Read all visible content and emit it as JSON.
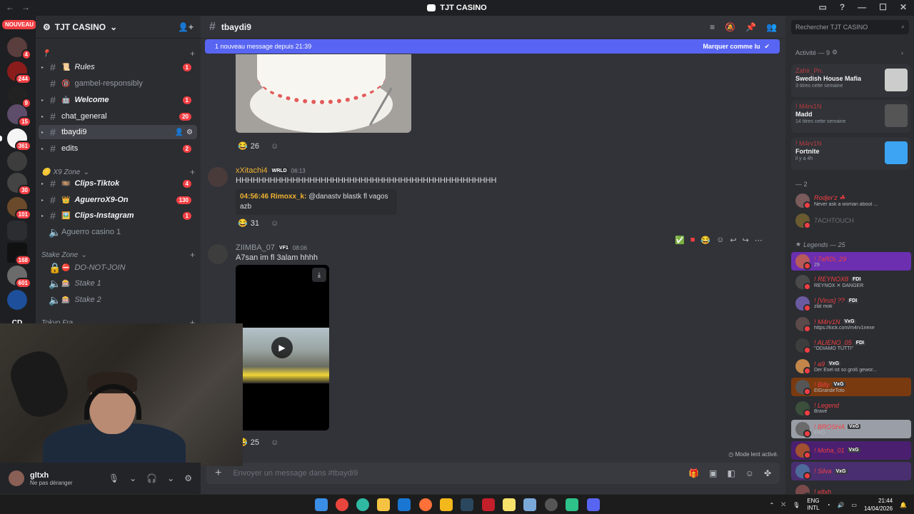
{
  "window": {
    "title": "TJT CASINO"
  },
  "server": {
    "name": "TJT CASINO"
  },
  "guild_badges": {
    "new": "NOUVEAU",
    "b1": "4",
    "b2": "244",
    "b3": "9",
    "b4": "15",
    "b5": "361",
    "b6": "30",
    "b7": "101",
    "b8": "168",
    "b9": "601",
    "cd": "CD"
  },
  "categories": {
    "cat1": "📍",
    "x9": "X9 Zone",
    "stake": "Stake Zone",
    "tokyo": "Tokyo Fra"
  },
  "channels": {
    "rules": {
      "label": "Rules",
      "emoji": "📜",
      "count": "1"
    },
    "gamble": {
      "label": "gambel-responsibly",
      "emoji": "🔞"
    },
    "welcome": {
      "label": "Welcome",
      "emoji": "🤖",
      "count": "1"
    },
    "chat_general": {
      "label": "chat_general",
      "count": "20"
    },
    "tbaydi9": {
      "label": "tbaydi9"
    },
    "edits": {
      "label": "edits",
      "count": "2"
    },
    "clips_tiktok": {
      "label": "Clips-Tiktok",
      "emoji": "🎞️",
      "count": "4"
    },
    "aguerro": {
      "label": "AguerroX9-On",
      "emoji": "👑",
      "count": "130"
    },
    "clips_insta": {
      "label": "Clips-Instagram",
      "emoji": "🖼️",
      "count": "1"
    },
    "aguerro_voice": {
      "label": "Aguerro casino 1"
    },
    "do_not_join": {
      "label": "DO-NOT-JOIN",
      "emoji": "⛔"
    },
    "stake1": {
      "label": "Stake 1",
      "emoji": "🎰"
    },
    "stake2": {
      "label": "Stake 2",
      "emoji": "🎰"
    }
  },
  "user": {
    "name": "gltxh",
    "status": "Ne pas déranger"
  },
  "header": {
    "channel": "tbaydi9"
  },
  "newbar": {
    "text": "1 nouveau message depuis 21:39",
    "action": "Marquer comme lu"
  },
  "messages": {
    "r1": {
      "emoji": "😂",
      "count": "26"
    },
    "m2": {
      "author": "xXitachi4",
      "tag": "WRLD",
      "time": "06:13",
      "text": "HHHHHHHHHHHHHHHHHHHHHHHHHHHHHHHHHHHHHHHHHHHHHH",
      "quote_time": "04:56:46",
      "quote_author": "Rimoxx_k:",
      "quote_text": "@danastv blastk fl vagos",
      "quote_text2": "azb"
    },
    "r2": {
      "emoji": "😂",
      "count": "31"
    },
    "m3": {
      "author": "ZIIMBA_07",
      "tag": "VF1",
      "time": "08:06",
      "text": "A7san im fl 3alam hhhh"
    },
    "r3": {
      "emoji": "😂",
      "count": "25"
    }
  },
  "slowmode": "Mode lent activé.",
  "composer": {
    "placeholder": "Envoyer un message dans #tbaydi9"
  },
  "search": {
    "placeholder": "Rechercher TJT CASINO"
  },
  "activity_header": "Activité — 9",
  "activities": [
    {
      "who": "Zahir_Pn.",
      "what": "Swedish House Mafia",
      "sub": "3 titres cette semaine"
    },
    {
      "who": "! M4rv1N",
      "what": "Madd",
      "sub": "14 titres cette semaine"
    },
    {
      "who": "! M4rv1N",
      "what": "Fortnite",
      "sub": "il y a 4h"
    }
  ],
  "group2_header": "— 2",
  "group2": [
    {
      "name": "Rodjer'z ☘",
      "status": "Never ask a woman about ..."
    },
    {
      "name": "7ACHTOUCH",
      "status": ""
    }
  ],
  "legends_header": "Legends — 25",
  "legends": [
    {
      "name": "! 7aRDi_29",
      "tag": "",
      "status": "29"
    },
    {
      "name": "! REYNOX8",
      "tag": "FDI",
      "status": "REYNOX ✕ DANGER"
    },
    {
      "name": "! [Virus] ??",
      "tag": "FDI",
      "status": "zlal mok"
    },
    {
      "name": "! M4rv1N",
      "tag": "VxG",
      "status": "https://kick.com/m4rv1nexe"
    },
    {
      "name": "! ALIENO_05",
      "tag": "FDI",
      "status": "\"ODIAMO TUTTI\""
    },
    {
      "name": "! a9",
      "tag": "VxG",
      "status": "Der Esel ist so groß gewor..."
    },
    {
      "name": "! Billy",
      "tag": "VxG",
      "status": "ElGrandeToto"
    },
    {
      "name": "! Legend",
      "tag": "",
      "status": "Brave"
    },
    {
      "name": "! BROSHA",
      "tag": "VxG",
      "status": "ERO"
    },
    {
      "name": "! Moha_01",
      "tag": "VxG",
      "status": ""
    },
    {
      "name": "! Silva",
      "tag": "VxG",
      "status": ""
    },
    {
      "name": "! eltxh",
      "tag": "",
      "status": ""
    }
  ],
  "tray": {
    "lang1": "ENG",
    "lang2": "INTL",
    "time": "21:44",
    "date": "14/04/2026"
  }
}
